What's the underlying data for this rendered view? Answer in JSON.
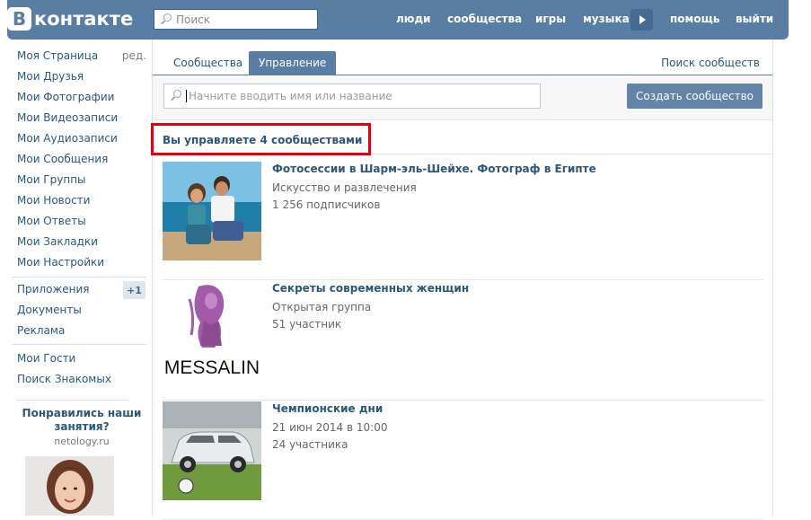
{
  "header": {
    "logo_letter": "В",
    "logo_text": "контакте",
    "search_placeholder": "Поиск",
    "nav": [
      "люди",
      "сообщества",
      "игры",
      "музыка",
      "помощь",
      "выйти"
    ]
  },
  "sidebar": {
    "items": [
      "Моя Страница",
      "Мои Друзья",
      "Мои Фотографии",
      "Мои Видеозаписи",
      "Мои Аудиозаписи",
      "Мои Сообщения",
      "Мои Группы",
      "Мои Новости",
      "Мои Ответы",
      "Мои Закладки",
      "Мои Настройки"
    ],
    "edit_label": "ред.",
    "secondary": [
      "Приложения",
      "Документы",
      "Реклама"
    ],
    "apps_badge": "+1",
    "tertiary": [
      "Мои Гости",
      "Поиск Знакомых"
    ],
    "ad": {
      "title": "Понравились наши занятия?",
      "domain": "netology.ru"
    }
  },
  "main": {
    "tabs": [
      "Сообщества",
      "Управление"
    ],
    "tab_right": "Поиск сообществ",
    "search_placeholder": "Начните вводить имя или название",
    "create_button": "Создать сообщество",
    "count_text": "Вы управляете 4 сообществами",
    "groups": [
      {
        "name": "Фотосессии в Шарм-эль-Шейхе. Фотограф в Египте",
        "category": "Искусство и развлечения",
        "members": "1 256 подписчиков"
      },
      {
        "name": "Секреты современных женщин",
        "category": "Открытая группа",
        "members": "51 участник",
        "thumb_text": "MESSALIN"
      },
      {
        "name": "Чемпионские дни",
        "category": "21 июн 2014 в 10:00",
        "members": "24 участника"
      }
    ]
  },
  "colors": {
    "header_blue": "#597da3",
    "link_blue": "#2b587a",
    "highlight_red": "#e2000f"
  }
}
